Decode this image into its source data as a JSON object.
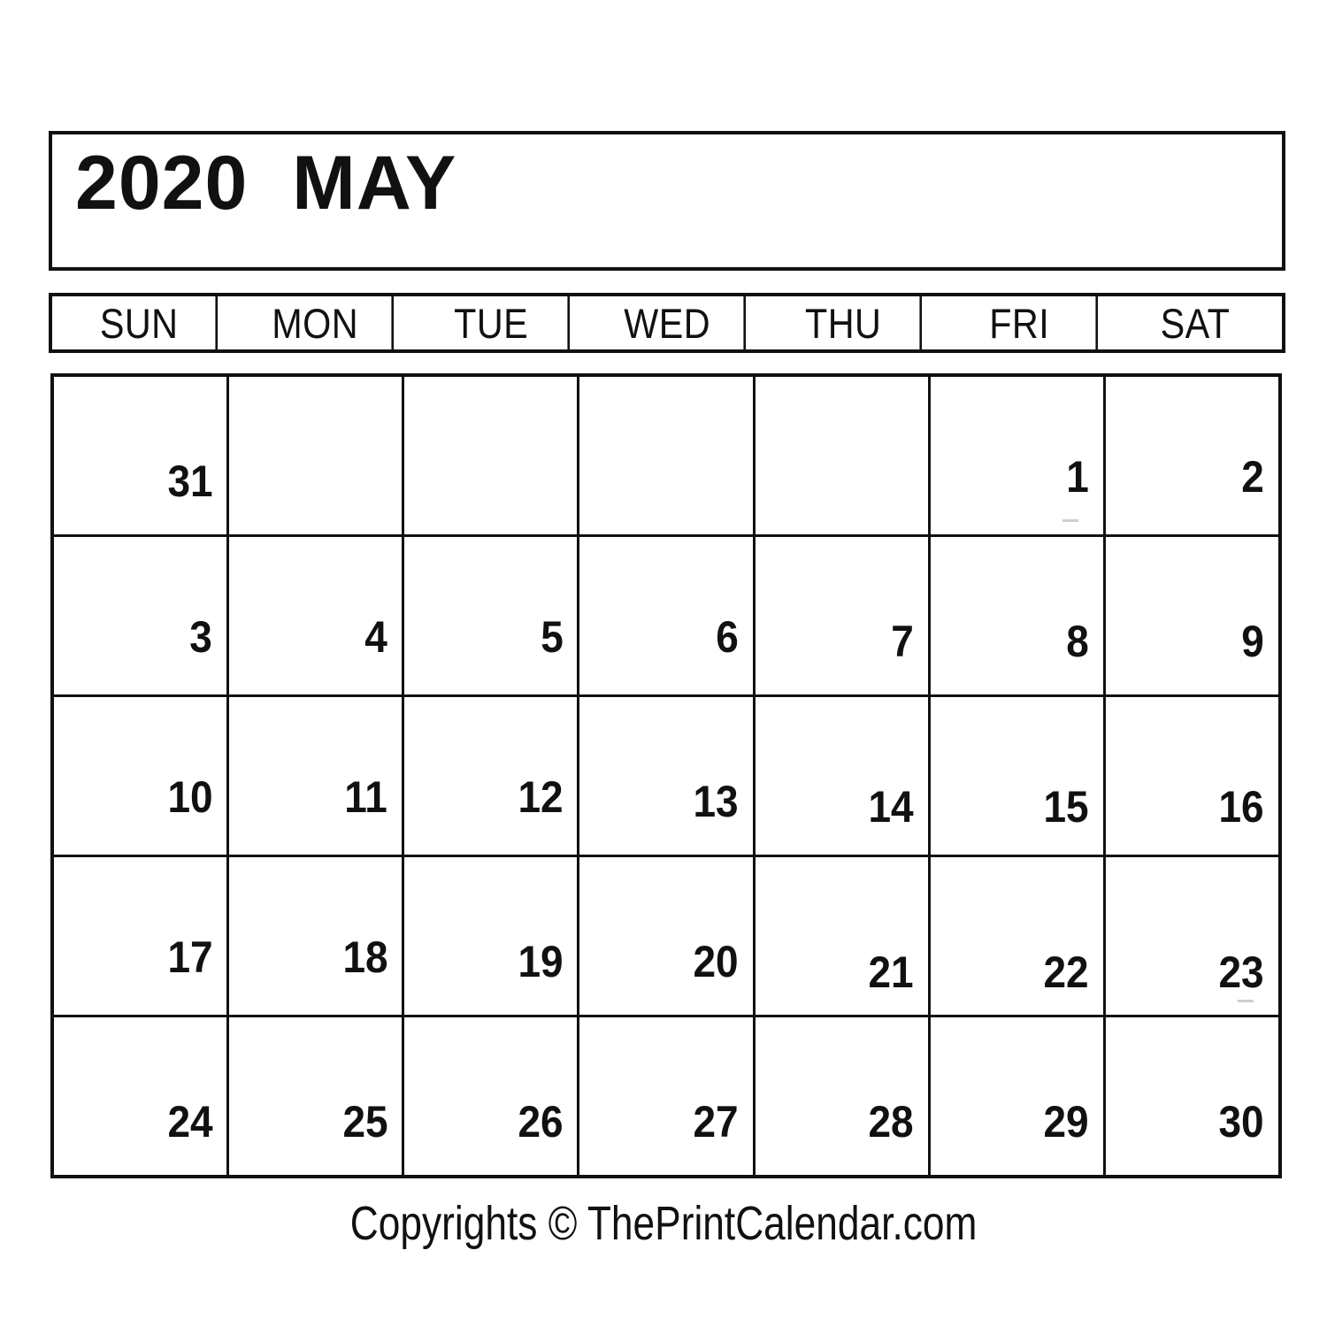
{
  "calendar": {
    "title": "2020  MAY",
    "year": "2020",
    "month": "MAY",
    "weekdays": [
      "SUN",
      "MON",
      "TUE",
      "WED",
      "THU",
      "FRI",
      "SAT"
    ],
    "weeks": [
      {
        "days": [
          {
            "label": "31",
            "stagger": 1
          },
          {
            "label": "",
            "stagger": 0
          },
          {
            "label": "",
            "stagger": 0
          },
          {
            "label": "",
            "stagger": 0
          },
          {
            "label": "",
            "stagger": 0
          },
          {
            "label": "1",
            "stagger": 0
          },
          {
            "label": "2",
            "stagger": 0
          }
        ]
      },
      {
        "days": [
          {
            "label": "3",
            "stagger": 0
          },
          {
            "label": "4",
            "stagger": 0
          },
          {
            "label": "5",
            "stagger": 0
          },
          {
            "label": "6",
            "stagger": 0
          },
          {
            "label": "7",
            "stagger": 1
          },
          {
            "label": "8",
            "stagger": 1
          },
          {
            "label": "9",
            "stagger": 1
          }
        ]
      },
      {
        "days": [
          {
            "label": "10",
            "stagger": 0
          },
          {
            "label": "11",
            "stagger": 0
          },
          {
            "label": "12",
            "stagger": 0
          },
          {
            "label": "13",
            "stagger": 1
          },
          {
            "label": "14",
            "stagger": 2
          },
          {
            "label": "15",
            "stagger": 2
          },
          {
            "label": "16",
            "stagger": 2
          }
        ]
      },
      {
        "days": [
          {
            "label": "17",
            "stagger": 0
          },
          {
            "label": "18",
            "stagger": 0
          },
          {
            "label": "19",
            "stagger": 1
          },
          {
            "label": "20",
            "stagger": 1
          },
          {
            "label": "21",
            "stagger": 3
          },
          {
            "label": "22",
            "stagger": 3
          },
          {
            "label": "23",
            "stagger": 3
          }
        ]
      },
      {
        "days": [
          {
            "label": "24",
            "stagger": 1
          },
          {
            "label": "25",
            "stagger": 1
          },
          {
            "label": "26",
            "stagger": 1
          },
          {
            "label": "27",
            "stagger": 1
          },
          {
            "label": "28",
            "stagger": 1
          },
          {
            "label": "29",
            "stagger": 1
          },
          {
            "label": "30",
            "stagger": 1
          }
        ]
      }
    ]
  },
  "footer": {
    "copyright": "Copyrights © ThePrintCalendar.com"
  },
  "colors": {
    "ink": "#111111",
    "paper": "#ffffff",
    "artifact": "#cfcfcf"
  }
}
